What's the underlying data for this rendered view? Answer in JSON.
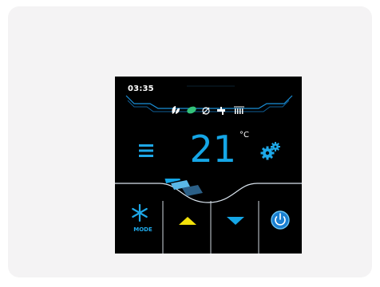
{
  "thermostat": {
    "time": "03:35",
    "temperature": "21",
    "unit": "°C",
    "mode_label": "MODE",
    "status_icons": [
      "leaf-icon",
      "eco-leaf-icon",
      "fan-icon",
      "faucet-icon",
      "radiator-icon"
    ],
    "fan_level_segments": 3
  },
  "colors": {
    "accent_blue": "#15a6e6",
    "green": "#33c27a",
    "yellow": "#f2e10a",
    "background": "#000000"
  }
}
